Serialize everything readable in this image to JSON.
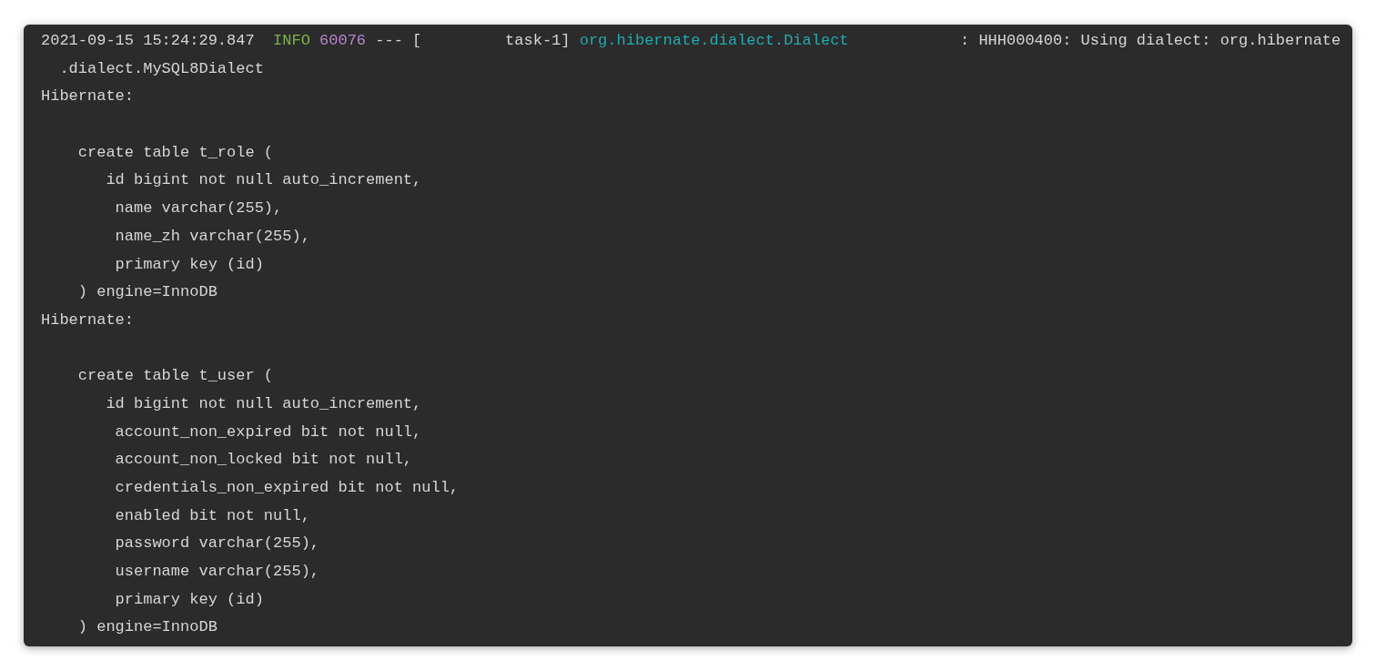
{
  "console": {
    "lines": [
      {
        "kind": "log",
        "segments": [
          {
            "kind": "timestamp",
            "text": "2021-09-15 15:24:29.847  "
          },
          {
            "kind": "level",
            "text": "INFO"
          },
          {
            "kind": "pid",
            "text": " 60076"
          },
          {
            "kind": "plain",
            "text": " --- [         task-1] "
          },
          {
            "kind": "logger",
            "text": "org.hibernate.dialect.Dialect"
          },
          {
            "kind": "plain",
            "text": "            : HHH000400: Using dialect: org.hibernate"
          }
        ]
      },
      {
        "kind": "text",
        "text": "  .dialect.MySQL8Dialect"
      },
      {
        "kind": "text",
        "text": "Hibernate:"
      },
      {
        "kind": "blank"
      },
      {
        "kind": "text",
        "text": "    create table t_role ("
      },
      {
        "kind": "text",
        "text": "       id bigint not null auto_increment,"
      },
      {
        "kind": "text",
        "text": "        name varchar(255),"
      },
      {
        "kind": "text",
        "text": "        name_zh varchar(255),"
      },
      {
        "kind": "text",
        "text": "        primary key (id)"
      },
      {
        "kind": "text",
        "text": "    ) engine=InnoDB"
      },
      {
        "kind": "text",
        "text": "Hibernate:"
      },
      {
        "kind": "blank"
      },
      {
        "kind": "text",
        "text": "    create table t_user ("
      },
      {
        "kind": "text",
        "text": "       id bigint not null auto_increment,"
      },
      {
        "kind": "text",
        "text": "        account_non_expired bit not null,"
      },
      {
        "kind": "text",
        "text": "        account_non_locked bit not null,"
      },
      {
        "kind": "text",
        "text": "        credentials_non_expired bit not null,"
      },
      {
        "kind": "text",
        "text": "        enabled bit not null,"
      },
      {
        "kind": "text",
        "text": "        password varchar(255),"
      },
      {
        "kind": "text",
        "text": "        username varchar(255),"
      },
      {
        "kind": "text",
        "text": "        primary key (id)"
      },
      {
        "kind": "text",
        "text": "    ) engine=InnoDB"
      }
    ]
  }
}
